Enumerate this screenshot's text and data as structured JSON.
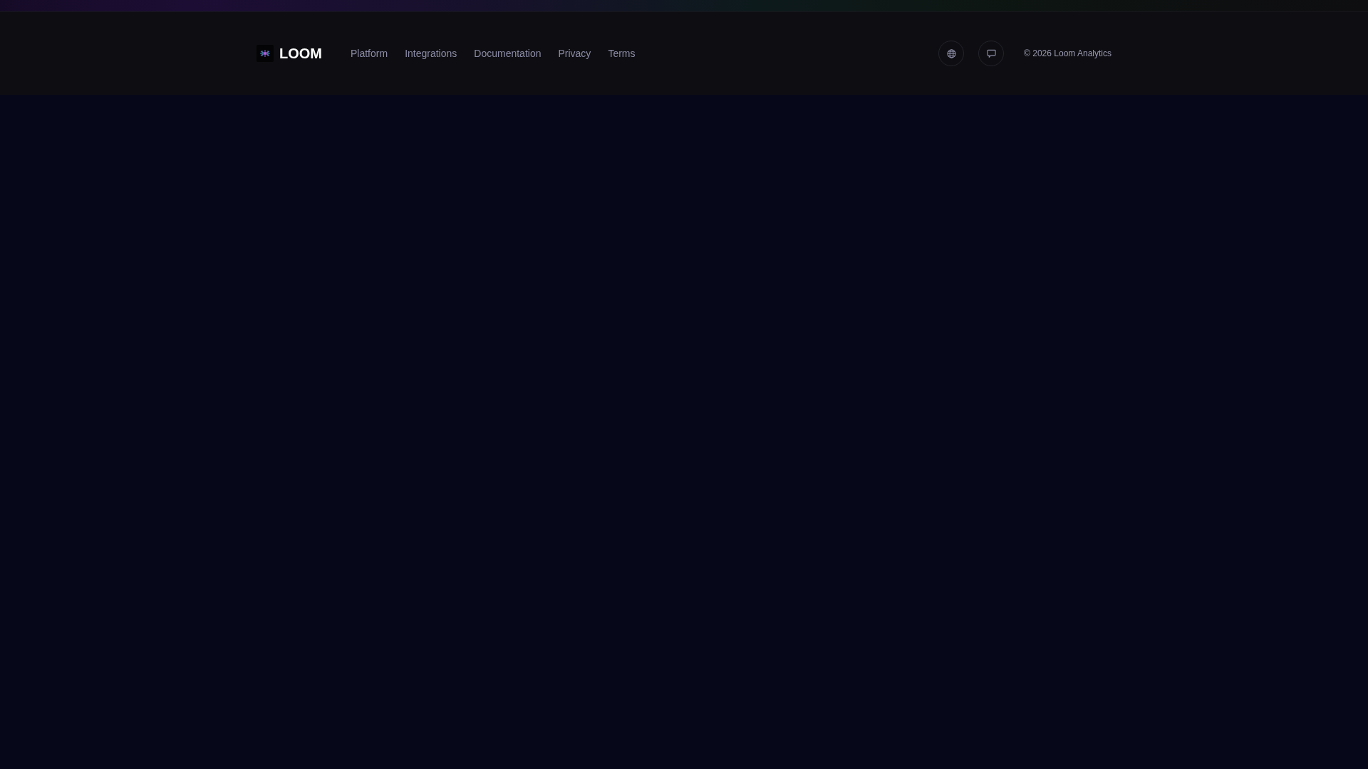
{
  "footer": {
    "brand": {
      "name": "LOOM"
    },
    "links": [
      {
        "label": "Platform"
      },
      {
        "label": "Integrations"
      },
      {
        "label": "Documentation"
      },
      {
        "label": "Privacy"
      },
      {
        "label": "Terms"
      }
    ],
    "copyright": "© 2026 Loom Analytics"
  }
}
